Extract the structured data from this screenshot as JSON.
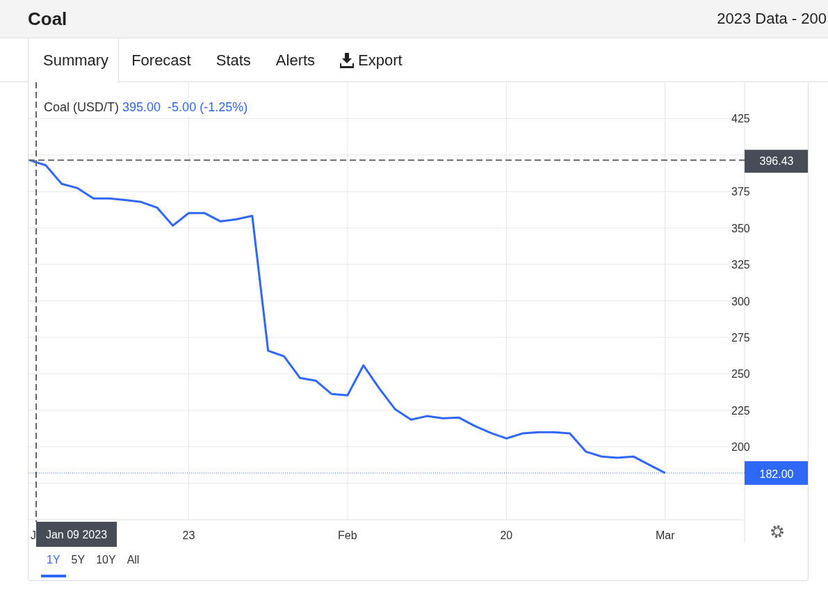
{
  "header": {
    "title": "Coal",
    "subtitle": "2023 Data - 200"
  },
  "tabs": [
    {
      "label": "Summary",
      "selected": true,
      "kind": "text"
    },
    {
      "label": "Forecast",
      "selected": false,
      "kind": "text"
    },
    {
      "label": "Stats",
      "selected": false,
      "kind": "text"
    },
    {
      "label": "Alerts",
      "selected": false,
      "kind": "text"
    },
    {
      "label": "Export",
      "selected": false,
      "kind": "export"
    }
  ],
  "chart": {
    "legend": {
      "price": "395.00",
      "change": "-5.00 (-1.25%)"
    },
    "crosshair": {
      "value_label": "396.43",
      "date_label": "Jan 09 2023"
    },
    "last_label": "182.00",
    "chart_data": {
      "type": "line",
      "categories": [
        "J",
        null,
        null,
        null,
        null,
        null,
        null,
        null,
        null,
        null,
        "23",
        null,
        null,
        null,
        null,
        null,
        null,
        null,
        null,
        null,
        "Feb",
        null,
        null,
        null,
        null,
        null,
        null,
        null,
        null,
        null,
        "20",
        null,
        null,
        null,
        null,
        null,
        null,
        null,
        null,
        null,
        "Mar"
      ],
      "series": [
        {
          "name": "Coal (USD/T)",
          "color": "#2f67f6",
          "values": [
            396.4,
            393,
            380.2,
            377.3,
            370.2,
            370.2,
            369.2,
            367.8,
            364,
            351.6,
            360.2,
            360.2,
            354.5,
            355.9,
            358.3,
            265.8,
            262,
            247.2,
            245.3,
            236.2,
            235.3,
            255.8,
            240,
            225.7,
            218.6,
            221,
            219.5,
            220,
            214.3,
            209.5,
            205.7,
            209.1,
            210,
            210,
            209.1,
            196.7,
            193.3,
            192.4,
            193.3,
            187.6,
            182
          ]
        }
      ],
      "ylim": [
        150,
        450
      ],
      "grid": true,
      "ref_lines": [
        {
          "axis": "y",
          "value": 396.43
        },
        {
          "axis": "y",
          "value": 182
        }
      ],
      "yticks": [
        200,
        225,
        250,
        275,
        300,
        325,
        350,
        375,
        425
      ]
    }
  },
  "ranges": [
    {
      "label": "1Y",
      "selected": true
    },
    {
      "label": "5Y",
      "selected": false
    },
    {
      "label": "10Y",
      "selected": false
    },
    {
      "label": "All",
      "selected": false
    }
  ]
}
